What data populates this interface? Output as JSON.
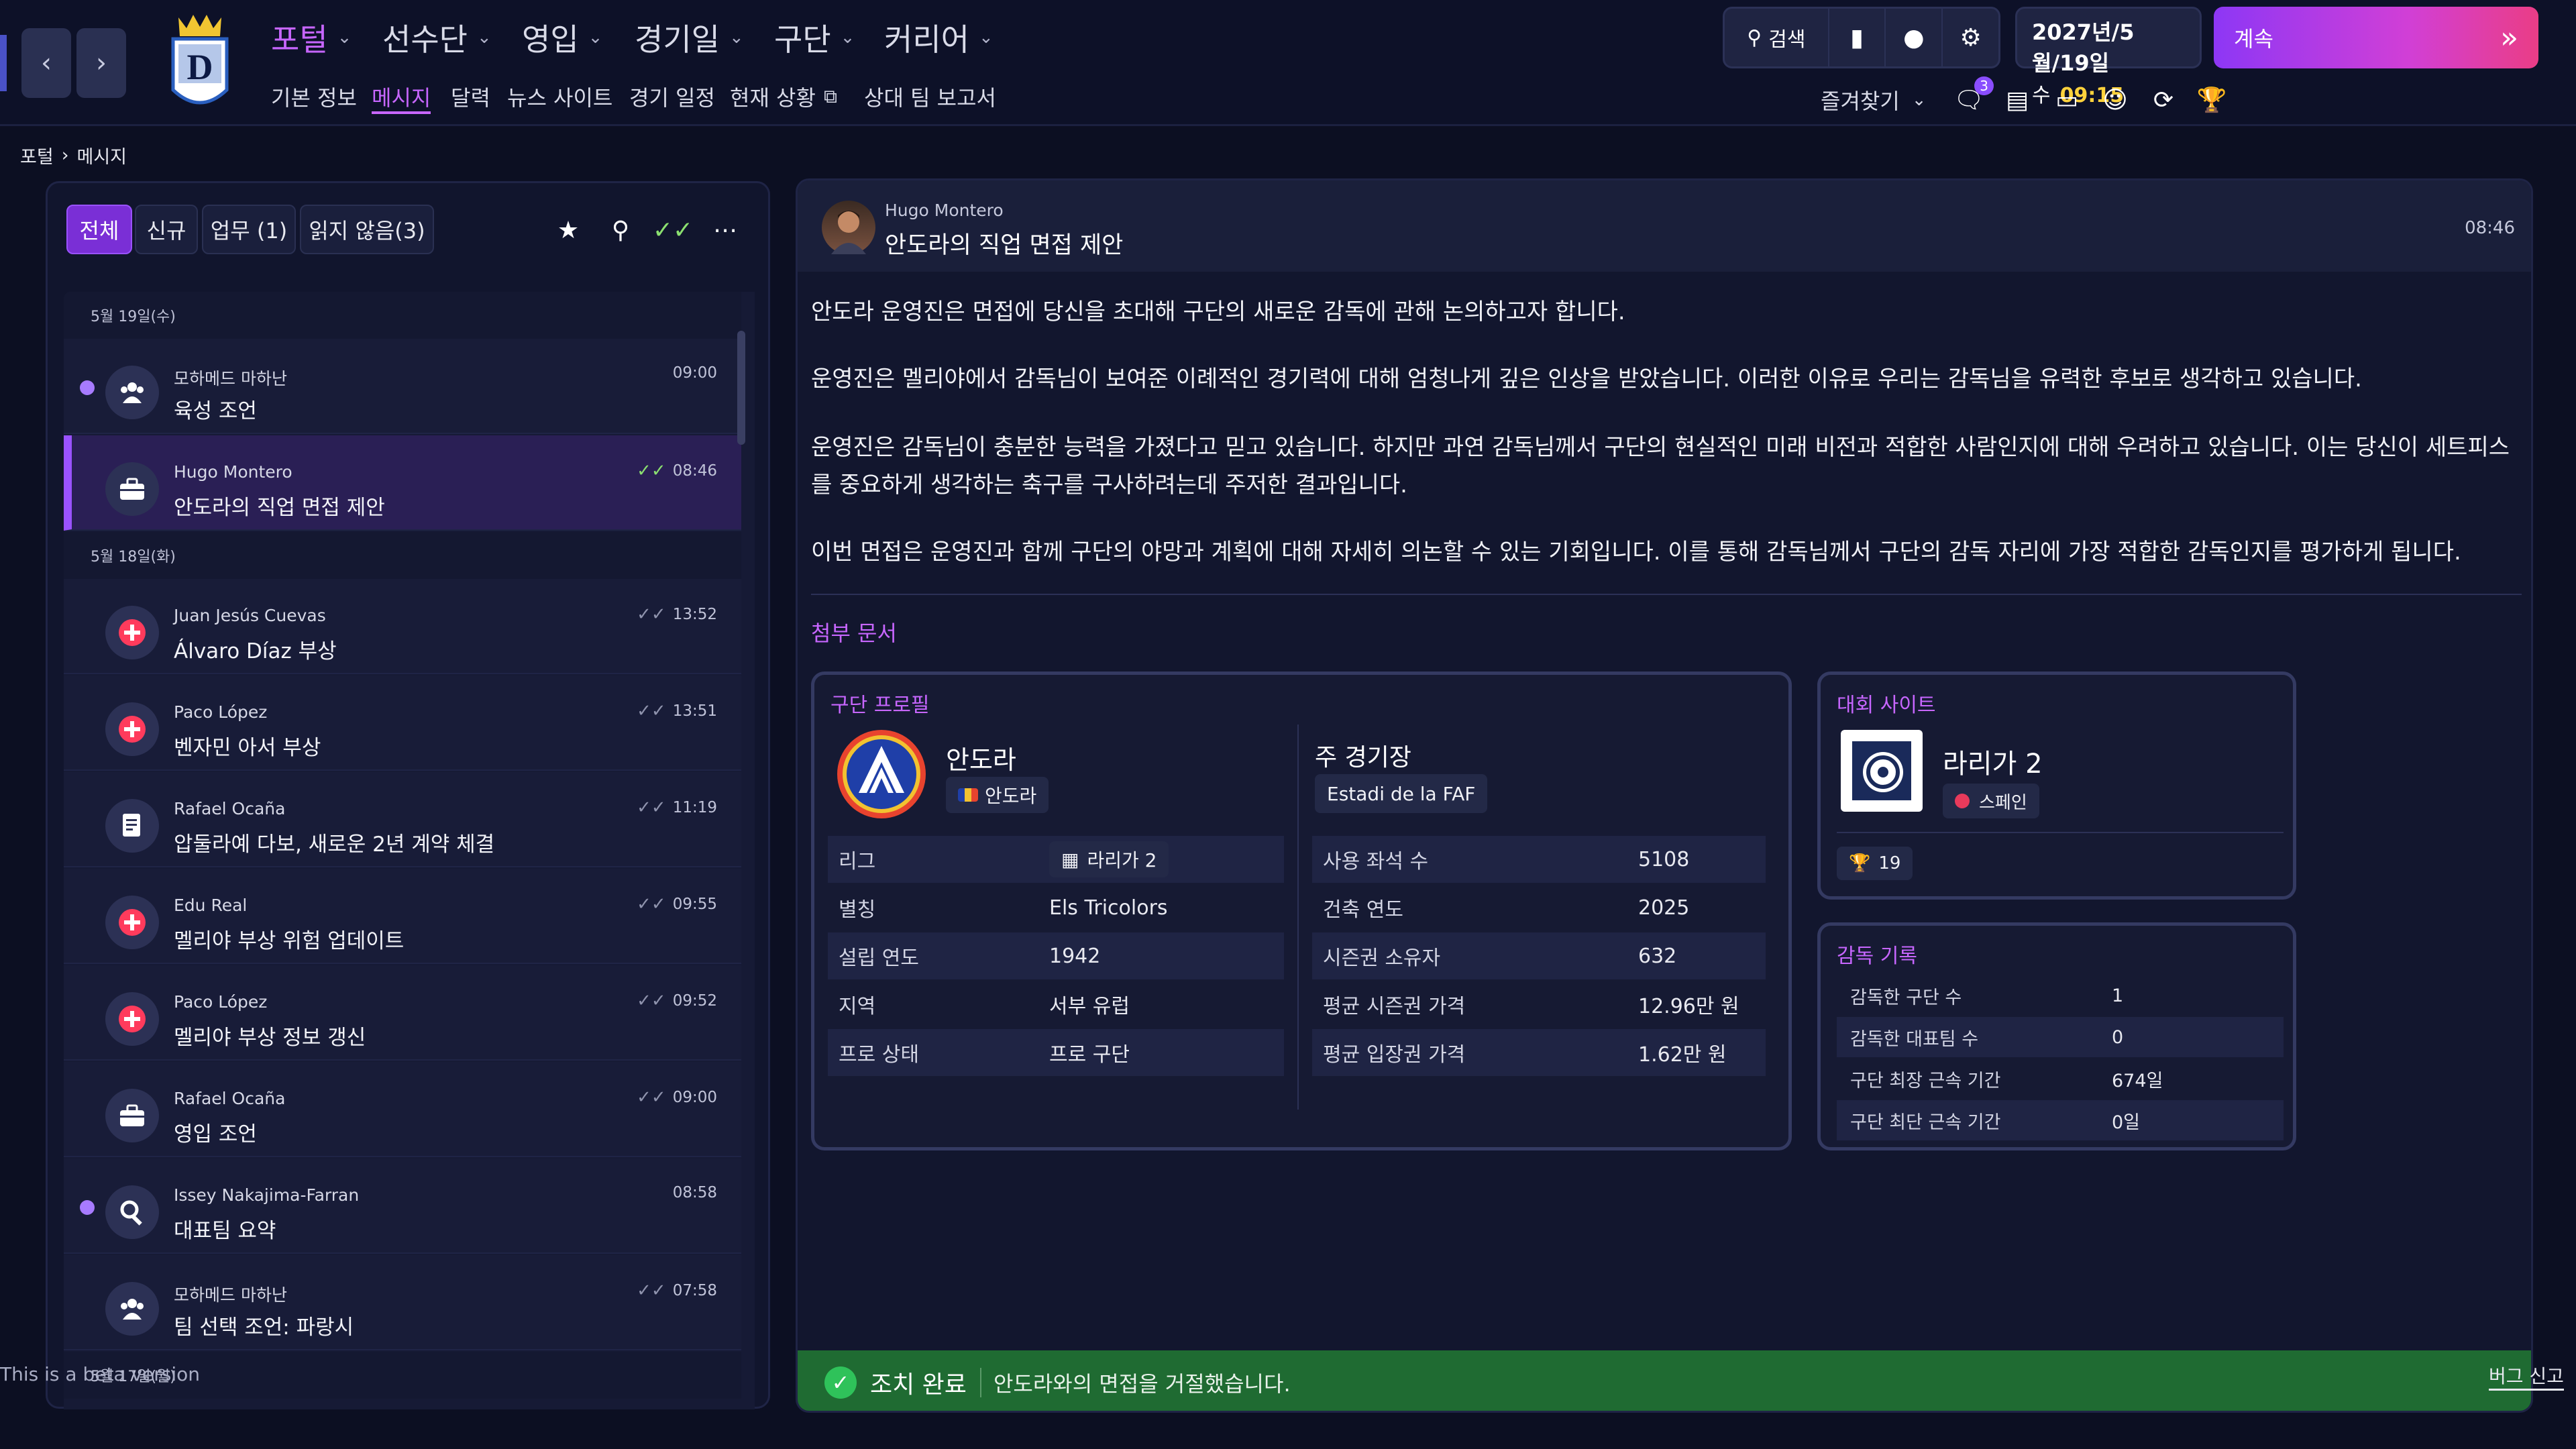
{
  "topbar": {
    "main_nav": [
      {
        "label": "포털",
        "active": true
      },
      {
        "label": "선수단",
        "active": false
      },
      {
        "label": "영입",
        "active": false
      },
      {
        "label": "경기일",
        "active": false
      },
      {
        "label": "구단",
        "active": false
      },
      {
        "label": "커리어",
        "active": false
      }
    ],
    "sub_nav": [
      {
        "label": "기본 정보",
        "active": false
      },
      {
        "label": "메시지",
        "active": true
      },
      {
        "label": "달력",
        "active": false
      },
      {
        "label": "뉴스 사이트",
        "active": false
      },
      {
        "label": "경기 일정",
        "active": false
      },
      {
        "label": "현재 상황",
        "active": false
      },
      {
        "label": "상대 팀 보고서",
        "active": false
      }
    ],
    "search_label": "검색",
    "date": "2027년/5월/19일",
    "weekday": "수",
    "time": "09:15",
    "continue_label": "계속",
    "favorites_label": "즐겨찾기",
    "message_badge": "3",
    "accent_color": "#c766ff"
  },
  "breadcrumb": {
    "root": "포털",
    "current": "메시지"
  },
  "inbox": {
    "filters": [
      {
        "label": "전체",
        "active": true
      },
      {
        "label": "신규",
        "active": false
      },
      {
        "label": "업무 (1)",
        "active": false
      },
      {
        "label": "읽지 않음(3)",
        "active": false
      }
    ],
    "groups": [
      {
        "day": "5월 19일(수)",
        "messages": [
          {
            "sender": "모하메드 마하난",
            "subject": "육성 조언",
            "time": "09:00",
            "icon": "staff-icon",
            "unread": true,
            "read_check": "none"
          },
          {
            "sender": "Hugo Montero",
            "subject": "안도라의 직업 면접 제안",
            "time": "08:46",
            "icon": "briefcase-icon",
            "unread": false,
            "read_check": "green",
            "selected": true
          }
        ]
      },
      {
        "day": "5월 18일(화)",
        "messages": [
          {
            "sender": "Juan Jesús Cuevas",
            "subject": "Álvaro Díaz 부상",
            "time": "13:52",
            "icon": "injury-icon",
            "unread": false,
            "read_check": "dim"
          },
          {
            "sender": "Paco López",
            "subject": "벤자민 아서 부상",
            "time": "13:51",
            "icon": "injury-icon",
            "unread": false,
            "read_check": "dim"
          },
          {
            "sender": "Rafael Ocaña",
            "subject": "압둘라예 다보, 새로운 2년 계약 체결",
            "time": "11:19",
            "icon": "contract-icon",
            "unread": false,
            "read_check": "dim"
          },
          {
            "sender": "Edu Real",
            "subject": "멜리야 부상 위험 업데이트",
            "time": "09:55",
            "icon": "injury-icon",
            "unread": false,
            "read_check": "dim"
          },
          {
            "sender": "Paco López",
            "subject": "멜리야 부상 정보 갱신",
            "time": "09:52",
            "icon": "injury-icon",
            "unread": false,
            "read_check": "dim"
          },
          {
            "sender": "Rafael Ocaña",
            "subject": "영입 조언",
            "time": "09:00",
            "icon": "briefcase-icon",
            "unread": false,
            "read_check": "dim"
          },
          {
            "sender": "Issey Nakajima-Farran",
            "subject": "대표팀 요약",
            "time": "08:58",
            "icon": "scout-icon",
            "unread": true,
            "read_check": "none"
          },
          {
            "sender": "모하메드 마하난",
            "subject": "팀 선택 조언: 파랑시",
            "time": "07:58",
            "icon": "staff-icon",
            "unread": false,
            "read_check": "dim"
          }
        ]
      },
      {
        "day": "5월 17일(월)",
        "messages": []
      }
    ]
  },
  "message": {
    "sender": "Hugo Montero",
    "subject": "안도라의 직업 면접 제안",
    "time": "08:46",
    "paragraphs": [
      "안도라 운영진은 면접에 당신을 초대해 구단의 새로운 감독에 관해 논의하고자 합니다.",
      "운영진은 멜리야에서 감독님이 보여준 이례적인 경기력에 대해 엄청나게 깊은 인상을 받았습니다. 이러한 이유로 우리는 감독님을 유력한 후보로 생각하고 있습니다.",
      "운영진은 감독님이 충분한 능력을 가졌다고 믿고 있습니다. 하지만 과연 감독님께서 구단의 현실적인 미래 비전과 적합한 사람인지에 대해 우려하고 있습니다. 이는 당신이 세트피스를 중요하게 생각하는 축구를 구사하려는데 주저한 결과입니다.",
      "이번 면접은 운영진과 함께 구단의 야망과 계획에 대해 자세히 의논할 수 있는 기회입니다. 이를 통해 감독님께서 구단의 감독 자리에 가장 적합한 감독인지를 평가하게 됩니다."
    ],
    "attachments_label": "첨부 문서",
    "club_profile": {
      "title": "구단 프로필",
      "club_name": "안도라",
      "country": "안도라",
      "stadium_label": "주 경기장",
      "stadium_name": "Estadi de la FAF",
      "left_rows": [
        {
          "key": "리그",
          "value": "라리가 2"
        },
        {
          "key": "별칭",
          "value": "Els Tricolors"
        },
        {
          "key": "설립 연도",
          "value": "1942"
        },
        {
          "key": "지역",
          "value": "서부 유럽"
        },
        {
          "key": "프로 상태",
          "value": "프로 구단"
        }
      ],
      "right_rows": [
        {
          "key": "사용 좌석 수",
          "value": "5108"
        },
        {
          "key": "건축 연도",
          "value": "2025"
        },
        {
          "key": "시즌권 소유자",
          "value": "632"
        },
        {
          "key": "평균 시즌권 가격",
          "value": "12.96만 원"
        },
        {
          "key": "평균 입장권 가격",
          "value": "1.62만 원"
        }
      ]
    },
    "competition": {
      "title": "대회 사이트",
      "name": "라리가 2",
      "country": "스페인",
      "trophies": "19"
    },
    "manager_record": {
      "title": "감독 기록",
      "rows": [
        {
          "key": "감독한 구단 수",
          "value": "1"
        },
        {
          "key": "감독한 대표팀 수",
          "value": "0"
        },
        {
          "key": "구단 최장 근속 기간",
          "value": "674일"
        },
        {
          "key": "구단 최단 근속 기간",
          "value": "0일"
        }
      ]
    },
    "action": {
      "status": "조치 완료",
      "text": "안도라와의 면접을 거절했습니다."
    }
  },
  "footer": {
    "beta": "This is a beta version",
    "bug_report": "버그 신고"
  }
}
